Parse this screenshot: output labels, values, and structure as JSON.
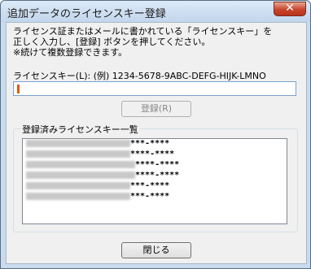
{
  "window": {
    "title": "追加データのライセンスキー登録",
    "close_label": "✕"
  },
  "instructions": "ライセンス証またはメールに書かれている「ライセンスキー」を\n正しく入力し、[登録] ボタンを押してください。\n※続けて複数登録できます。",
  "license_input": {
    "label": "ライセンスキー(L):   (例) 1234-5678-9ABC-DEFG-HIJK-LMNO",
    "value": ""
  },
  "register_button": "登録(R)",
  "registered_list": {
    "title": "登録済みライセンスキー一覧",
    "items": [
      {
        "suffix": "***-****"
      },
      {
        "suffix": "****-****"
      },
      {
        "suffix": "****-****"
      },
      {
        "suffix": "****-****"
      },
      {
        "suffix": "***-****"
      },
      {
        "suffix": "***-****"
      }
    ]
  },
  "close_button": "閉じる",
  "colors": {
    "caret": "#e05a00",
    "close": "#c8452d"
  }
}
